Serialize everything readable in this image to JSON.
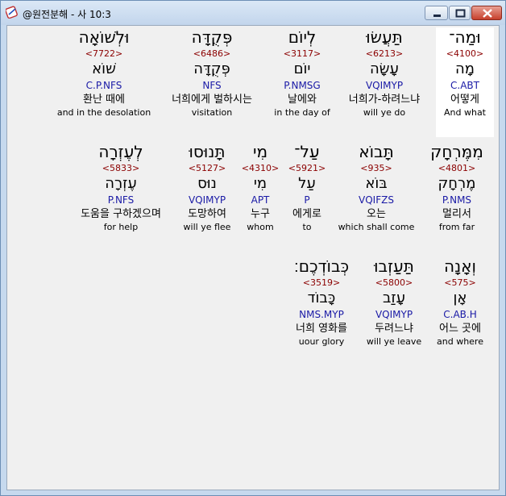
{
  "window": {
    "title": "@원전분해 - 사 10:3"
  },
  "rows": [
    [
      {
        "hebrew": "וּמַה־",
        "strong": "<4100>",
        "lemma": "מָה",
        "parse": "C.ABT",
        "korean": "어떻게",
        "english": "And what",
        "highlighted": true
      },
      {
        "hebrew": "תַּעֲשׂוּ",
        "strong": "<6213>",
        "lemma": "עָשָׂה",
        "parse": "VQIMYP",
        "korean": "너희가-하려느냐",
        "english": "will ye do"
      },
      {
        "hebrew": "לְיוֹם",
        "strong": "<3117>",
        "lemma": "יוֹם",
        "parse": "P.NMSG",
        "korean": "날에와",
        "english": "in the day of"
      },
      {
        "hebrew": "פְּקֻדָּה",
        "strong": "<6486>",
        "lemma": "פְּקֻדָּה",
        "parse": "NFS",
        "korean": "너희에게 벌하시는",
        "english": "visitation"
      },
      {
        "hebrew": "וּלְשׁוֹאָה",
        "strong": "<7722>",
        "lemma": "שׁוֹא",
        "parse": "C.P.NFS",
        "korean": "환난 때에",
        "english": "and in the desolation"
      }
    ],
    [
      {
        "hebrew": "מִמֶּרְחָק",
        "strong": "<4801>",
        "lemma": "מֶרְחָק",
        "parse": "P.NMS",
        "korean": "멀리서",
        "english": "from far"
      },
      {
        "hebrew": "תָּבוֹא",
        "strong": "<935>",
        "lemma": "בּוֹא",
        "parse": "VQIFZS",
        "korean": "오는",
        "english": "which shall come"
      },
      {
        "hebrew": "עַל־",
        "strong": "<5921>",
        "lemma": "עַל",
        "parse": "P",
        "korean": "에게로",
        "english": "to"
      },
      {
        "hebrew": "מִי",
        "strong": "<4310>",
        "lemma": "מִי",
        "parse": "APT",
        "korean": "누구",
        "english": "whom"
      },
      {
        "hebrew": "תָּנוּסוּ",
        "strong": "<5127>",
        "lemma": "נוּס",
        "parse": "VQIMYP",
        "korean": "도망하여",
        "english": "will ye flee"
      },
      {
        "hebrew": "לְעֶזְרָה",
        "strong": "<5833>",
        "lemma": "עֶזְרָה",
        "parse": "P.NFS",
        "korean": "도움을 구하겠으며",
        "english": "for help"
      }
    ],
    [
      {
        "hebrew": "וְאָנָה",
        "strong": "<575>",
        "lemma": "אָן",
        "parse": "C.AB.H",
        "korean": "어느 곳에",
        "english": "and where"
      },
      {
        "hebrew": "תַּעַזְבוּ",
        "strong": "<5800>",
        "lemma": "עָזַב",
        "parse": "VQIMYP",
        "korean": "두려느냐",
        "english": "will ye leave"
      },
      {
        "hebrew": "כְּבוֹדְכֶם׃",
        "strong": "<3519>",
        "lemma": "כָּבוֹד",
        "parse": "NMS.MYP",
        "korean": "너희 영화를",
        "english": "uour glory"
      }
    ]
  ]
}
